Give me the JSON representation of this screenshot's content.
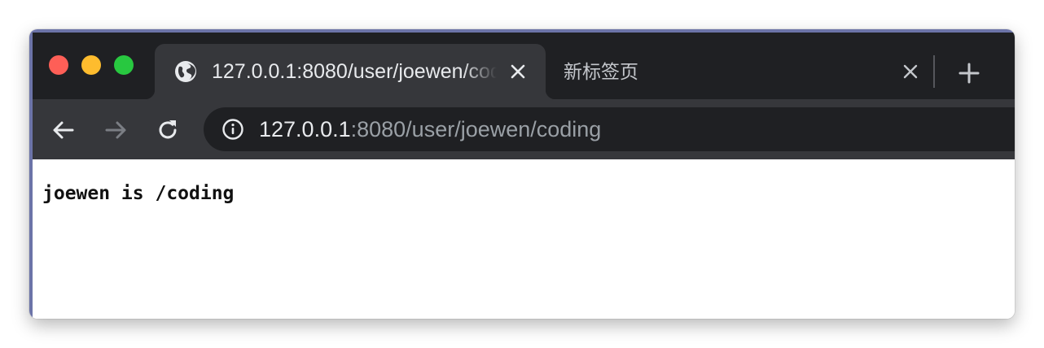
{
  "window": {
    "traffic_lights": {
      "close_color": "#fe5f57",
      "minimize_color": "#febc2e",
      "zoom_color": "#28c840"
    }
  },
  "tabs": [
    {
      "title": "127.0.0.1:8080/user/joewen/coding",
      "active": true,
      "favicon": "globe-icon",
      "close_icon": "close-icon"
    },
    {
      "title": "新标签页",
      "active": false,
      "close_icon": "close-icon"
    }
  ],
  "new_tab_icon": "plus-icon",
  "toolbar": {
    "back_icon": "arrow-left-icon",
    "forward_icon": "arrow-right-icon",
    "reload_icon": "reload-icon"
  },
  "address_bar": {
    "info_icon": "info-icon",
    "url_host": "127.0.0.1",
    "url_rest": ":8080/user/joewen/coding"
  },
  "page": {
    "body_text": "joewen is /coding"
  },
  "colors": {
    "tabstrip_bg": "#1f2023",
    "active_tab_bg": "#36373b",
    "omnibox_bg": "#1f2023",
    "url_host": "#e8eaed",
    "url_rest": "#9aa0a6",
    "frame_accent": "#6c74a8"
  }
}
